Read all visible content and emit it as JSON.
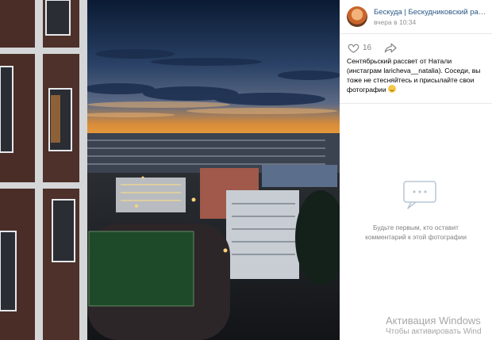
{
  "post": {
    "author": "Бескуда | Бескудниковский район ...",
    "time": "вчера в 10:34",
    "likes": "16",
    "caption": "Сентябрьский рассвет от Натали (инстаграм laricheva__natalia). Соседи, вы тоже не стесняйтесь и присылайте свои фотографии",
    "caption_emoji": "smiling-face-icon"
  },
  "comments": {
    "empty_text": "Будьте первым, кто оставит комментарий к этой фотографии"
  },
  "photo": {
    "subject": "sunrise over residential district",
    "sky_colors": [
      "#0a1a33",
      "#3d5577",
      "#f0a035"
    ]
  },
  "watermark": {
    "title": "Активация Windows",
    "subtitle": "Чтобы активировать Wind"
  },
  "colors": {
    "author_link": "#2a5885",
    "secondary_text": "#828282",
    "panel_bg": "#ffffff"
  }
}
